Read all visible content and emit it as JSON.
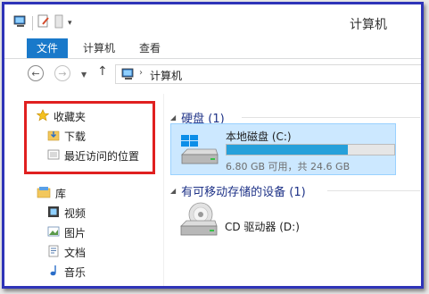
{
  "window": {
    "title": "计算机"
  },
  "ribbon": {
    "tabs": [
      "文件",
      "计算机",
      "查看"
    ]
  },
  "address": {
    "breadcrumb": "计算机"
  },
  "nav": {
    "favorites": {
      "label": "收藏夹",
      "items": [
        "下载",
        "最近访问的位置"
      ]
    },
    "libraries": {
      "label": "库",
      "items": [
        "视频",
        "图片",
        "文档",
        "音乐"
      ]
    }
  },
  "content": {
    "hard_disks": {
      "header": "硬盘 (1)",
      "drives": [
        {
          "name": "本地磁盘 (C:)",
          "status": "6.80 GB 可用，共 24.6 GB",
          "used_fraction": 0.724
        }
      ]
    },
    "removable": {
      "header": "有可移动存储的设备 (1)",
      "devices": [
        {
          "name": "CD 驱动器 (D:)"
        }
      ]
    }
  },
  "colors": {
    "highlight": "#e02020",
    "window_border": "#2e34b8",
    "file_tab": "#1979ca",
    "selection": "#cce8ff",
    "usage_bar": "#26a0da"
  }
}
